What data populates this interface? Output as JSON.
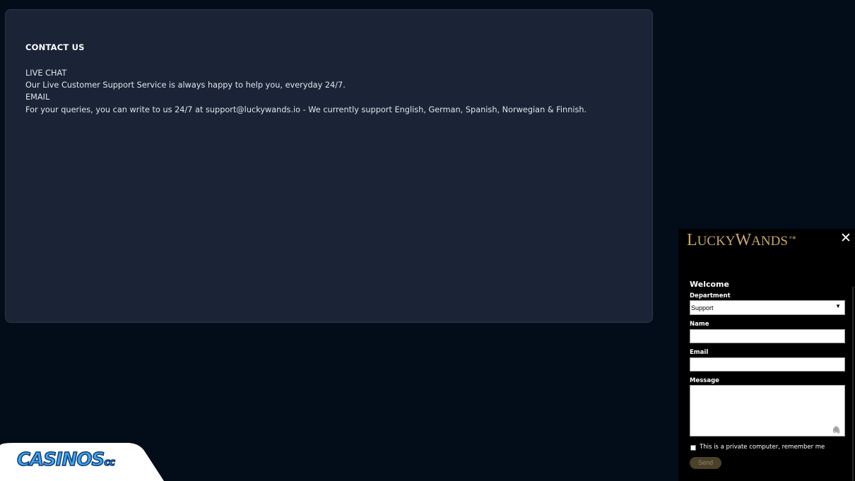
{
  "contact": {
    "title": "CONTACT US",
    "lines": [
      "LIVE CHAT",
      "Our Live Customer Support Service is always happy to help you, everyday 24/7.",
      "EMAIL",
      "For your queries, you can write to us 24/7 at support@luckywands.io - We currently support English, German, Spanish, Norwegian & Finnish."
    ]
  },
  "chat": {
    "logo": "LuckyWands",
    "logo_parts": [
      "L",
      "UCKY",
      "W",
      "ANDS"
    ],
    "close_icon": "close-icon",
    "welcome": "Welcome",
    "department_label": "Department",
    "department_value": "Support",
    "name_label": "Name",
    "email_label": "Email",
    "message_label": "Message",
    "remember_label": "This is a private computer, remember me",
    "send_label": "Send",
    "logo_color": "#c9a76a",
    "send_color": "#4b4129"
  },
  "badge": {
    "text": "CASINOS",
    "suffix": "cc",
    "color": "#3fa8e8"
  },
  "colors": {
    "background": "#030d19",
    "card": "#1a2436"
  }
}
